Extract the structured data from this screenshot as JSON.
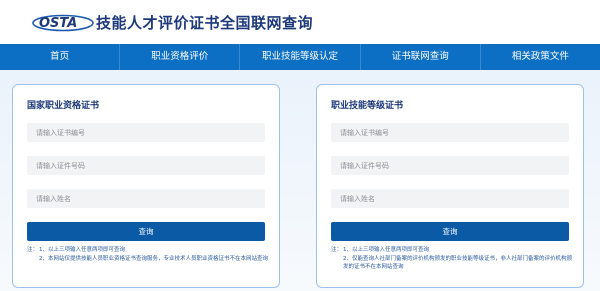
{
  "header": {
    "logo_text": "OSTA",
    "title": "技能人才评价证书全国联网查询"
  },
  "nav": {
    "items": [
      "首页",
      "职业资格评价",
      "职业技能等级认定",
      "证书联网查询",
      "相关政策文件"
    ]
  },
  "left_card": {
    "title": "国家职业资格证书",
    "fields": [
      {
        "placeholder": "请输入证书编号"
      },
      {
        "placeholder": "请输入证件号码"
      },
      {
        "placeholder": "请输入姓名"
      }
    ],
    "submit_label": "查询",
    "notes_label": "注：",
    "notes": [
      "1、以上三项输入任意两项即可查询",
      "2、本网站仅提供技能人员职业资格证书查询服务，专业技术人员职业资格证书不在本网站查询"
    ]
  },
  "right_card": {
    "title": "职业技能等级证书",
    "fields": [
      {
        "placeholder": "请输入证书编号"
      },
      {
        "placeholder": "请输入证件号码"
      },
      {
        "placeholder": "请输入姓名"
      }
    ],
    "submit_label": "查询",
    "notes_label": "注：",
    "notes": [
      "1、以上三项输入任意两项即可查询",
      "2、仅能查询人社部门备案的评价机构颁发的职业技能等级证书，非人社部门备案的评价机构颁发的证书不在本网站查询"
    ]
  },
  "colors": {
    "nav_bg": "#0c6fc4",
    "title": "#1e3a7a",
    "button": "#0b5aa6",
    "card_border": "#9cc2e8"
  }
}
